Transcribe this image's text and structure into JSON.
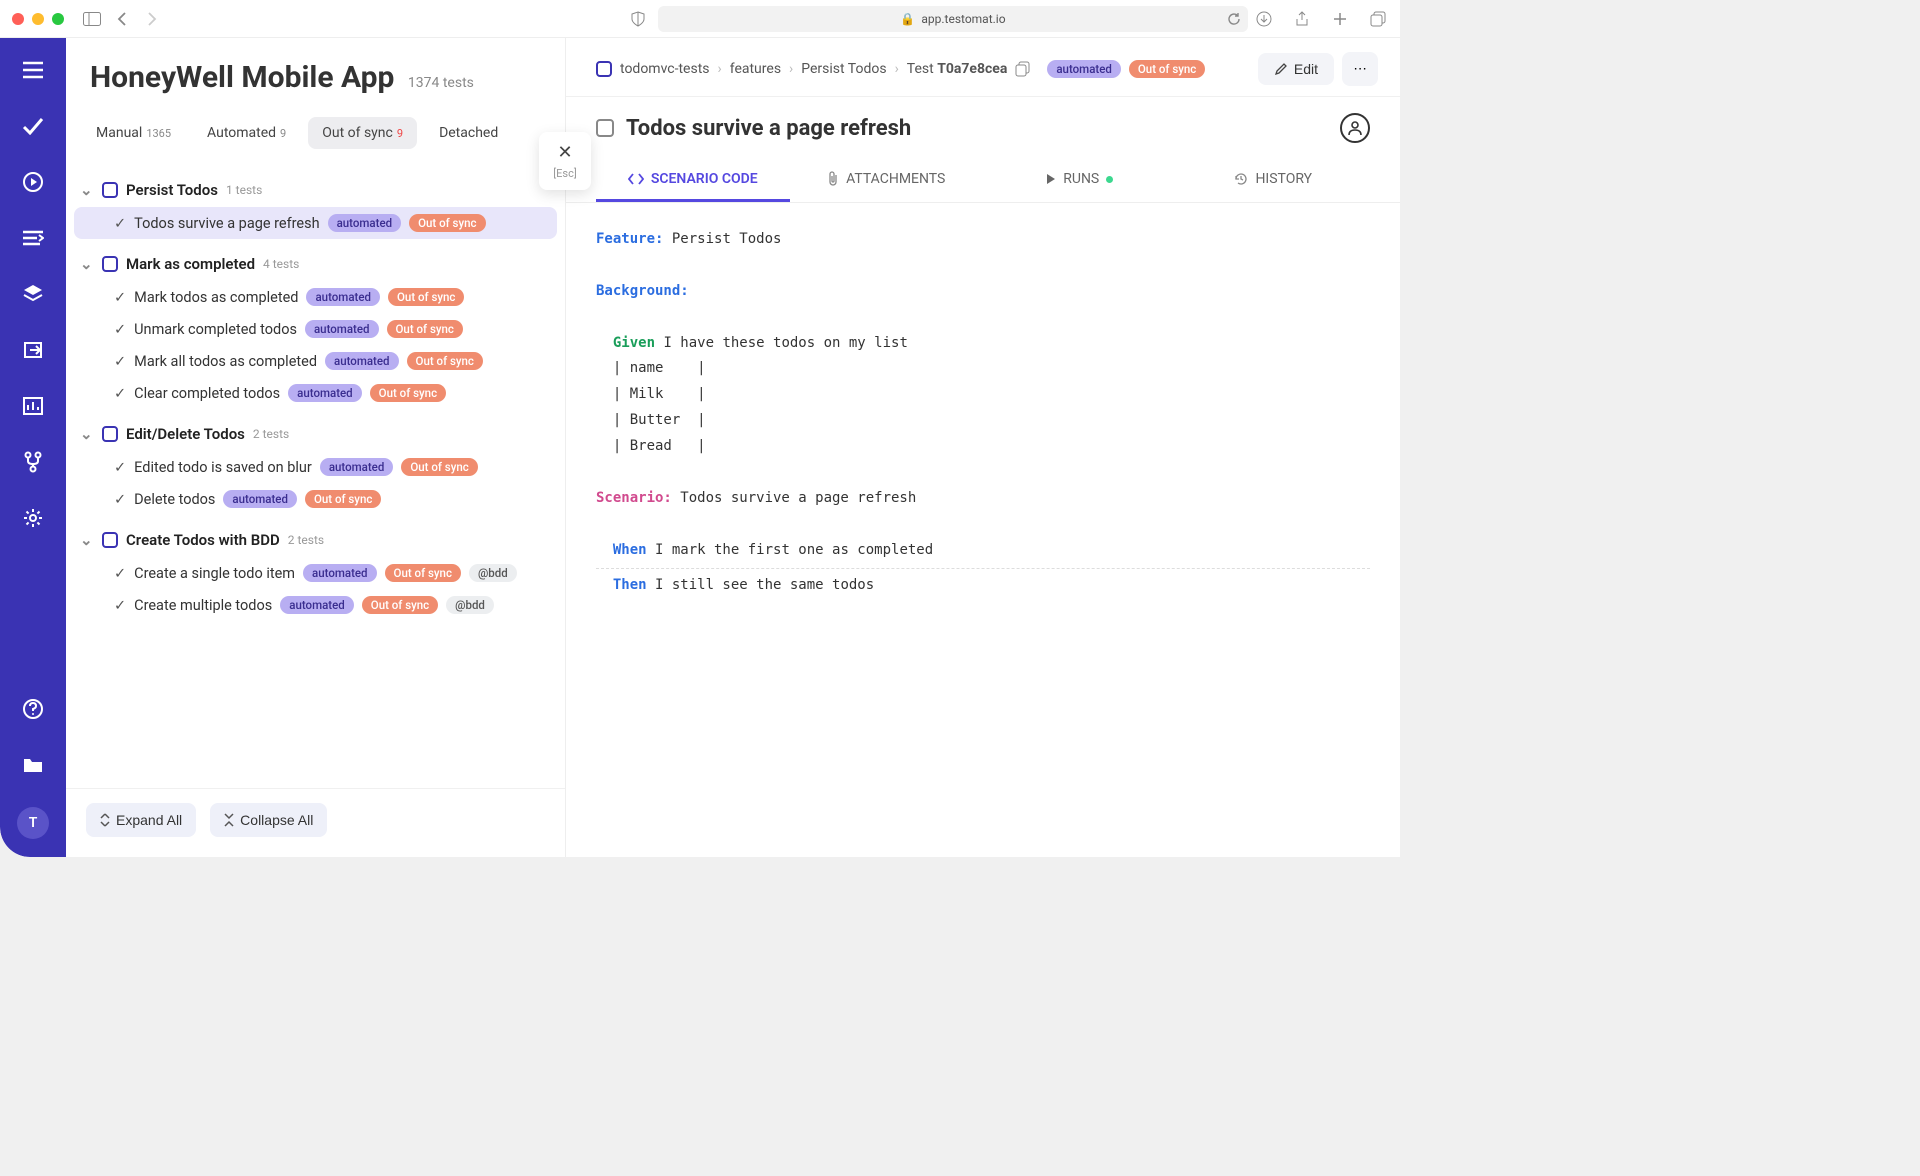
{
  "browser": {
    "url": "app.testomat.io"
  },
  "project": {
    "title": "HoneyWell Mobile App",
    "test_count": "1374 tests"
  },
  "tabs": {
    "manual": {
      "label": "Manual",
      "count": "1365"
    },
    "automated": {
      "label": "Automated",
      "count": "9"
    },
    "outofsync": {
      "label": "Out of sync",
      "count": "9"
    },
    "detached": {
      "label": "Detached"
    }
  },
  "suites": [
    {
      "name": "Persist Todos",
      "note": "1 tests",
      "tests": [
        {
          "name": "Todos survive a page refresh",
          "badges": [
            "automated",
            "Out of sync"
          ],
          "selected": true
        }
      ]
    },
    {
      "name": "Mark as completed",
      "note": "4 tests",
      "tests": [
        {
          "name": "Mark todos as completed",
          "badges": [
            "automated",
            "Out of sync"
          ]
        },
        {
          "name": "Unmark completed todos",
          "badges": [
            "automated",
            "Out of sync"
          ]
        },
        {
          "name": "Mark all todos as completed",
          "badges": [
            "automated",
            "Out of sync"
          ]
        },
        {
          "name": "Clear completed todos",
          "badges": [
            "automated",
            "Out of sync"
          ]
        }
      ]
    },
    {
      "name": "Edit/Delete Todos",
      "note": "2 tests",
      "tests": [
        {
          "name": "Edited todo is saved on blur",
          "badges": [
            "automated",
            "Out of sync"
          ]
        },
        {
          "name": "Delete todos",
          "badges": [
            "automated",
            "Out of sync"
          ]
        }
      ]
    },
    {
      "name": "Create Todos with BDD",
      "note": "2 tests",
      "tests": [
        {
          "name": "Create a single todo item",
          "badges": [
            "automated",
            "Out of sync",
            "@bdd"
          ]
        },
        {
          "name": "Create multiple todos",
          "badges": [
            "automated",
            "Out of sync",
            "@bdd"
          ]
        }
      ]
    }
  ],
  "footer": {
    "expand": "Expand All",
    "collapse": "Collapse All"
  },
  "close": {
    "esc": "[Esc]"
  },
  "detail": {
    "breadcrumb": [
      "todomvc-tests",
      "features",
      "Persist Todos"
    ],
    "breadcrumb_test_prefix": "Test ",
    "breadcrumb_test_id": "T0a7e8cea",
    "badges": [
      "automated",
      "Out of sync"
    ],
    "edit_label": "Edit",
    "title": "Todos survive a page refresh",
    "tabs": {
      "code": "SCENARIO CODE",
      "attachments": "ATTACHMENTS",
      "runs": "RUNS",
      "history": "HISTORY"
    },
    "code": {
      "feature_kw": "Feature:",
      "feature_name": " Persist Todos",
      "background_kw": "Background:",
      "given_kw": "Given",
      "given_text": " I have these todos on my list",
      "table": [
        "  | name    |",
        "  | Milk    |",
        "  | Butter  |",
        "  | Bread   |"
      ],
      "scenario_kw": "Scenario:",
      "scenario_name": " Todos survive a page refresh",
      "when_kw": "When",
      "when_text": " I mark the first one as completed",
      "then_kw": "Then",
      "then_text": " I still see the same todos"
    }
  },
  "avatar": "T"
}
